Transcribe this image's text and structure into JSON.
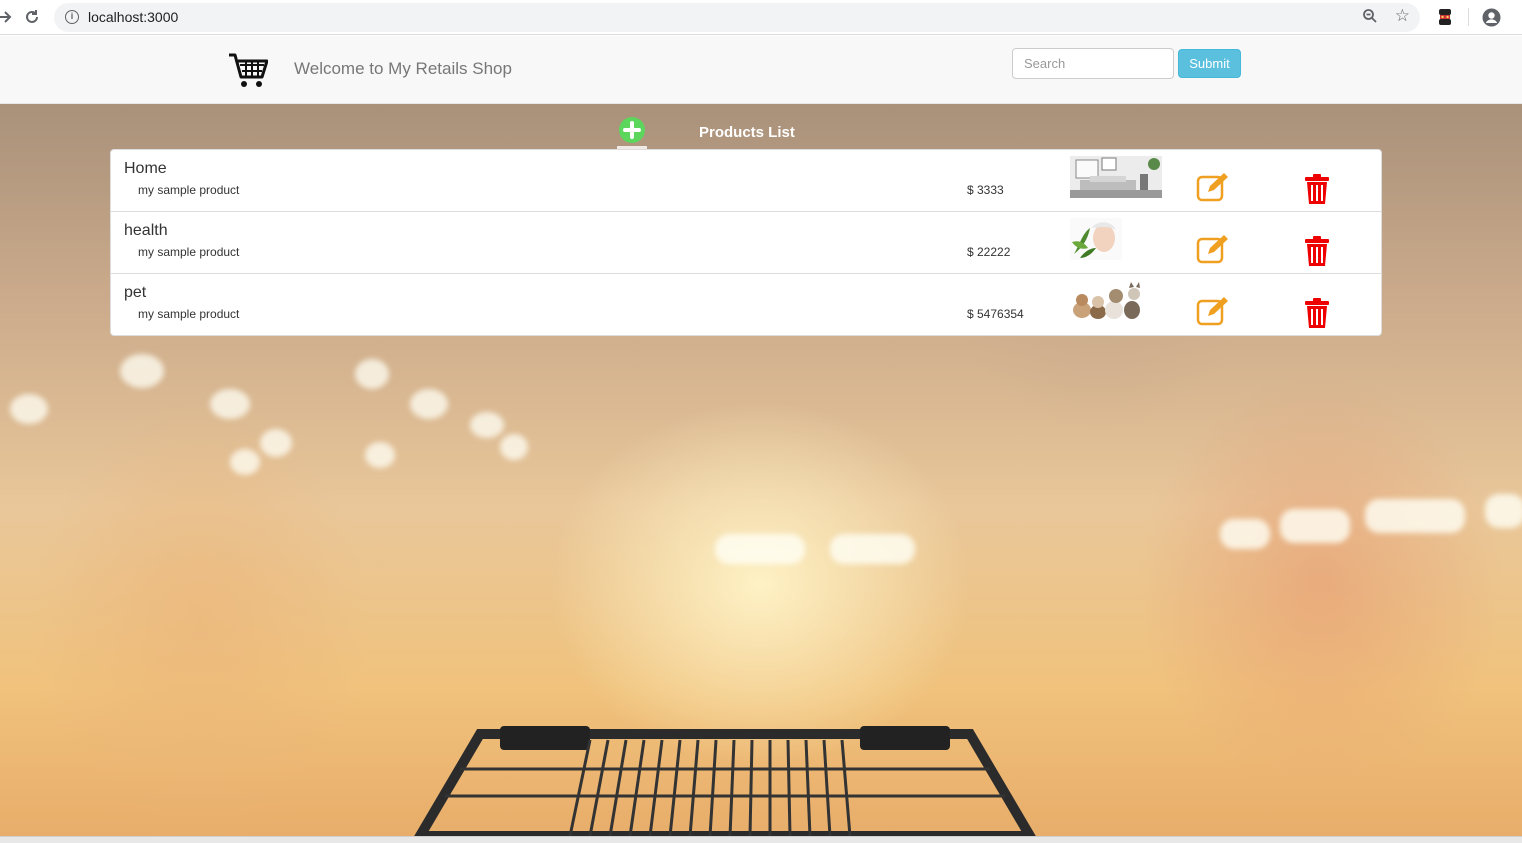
{
  "browser": {
    "url": "localhost:3000"
  },
  "navbar": {
    "brand_text": "Welcome to My Retails Shop",
    "search_placeholder": "Search",
    "submit_label": "Submit"
  },
  "products": {
    "title": "Products List",
    "items": [
      {
        "name": "Home",
        "description": "my sample product",
        "price": "$ 3333",
        "image": "living-room-image"
      },
      {
        "name": "health",
        "description": "my sample product",
        "price": "$ 22222",
        "image": "woman-with-plant-image"
      },
      {
        "name": "pet",
        "description": "my sample product",
        "price": "$ 5476354",
        "image": "pets-group-image"
      }
    ]
  },
  "colors": {
    "add_green": "#5cb85c",
    "edit_orange": "#f0ad4e",
    "delete_red": "#ee0000",
    "submit_blue": "#5bc0de"
  }
}
